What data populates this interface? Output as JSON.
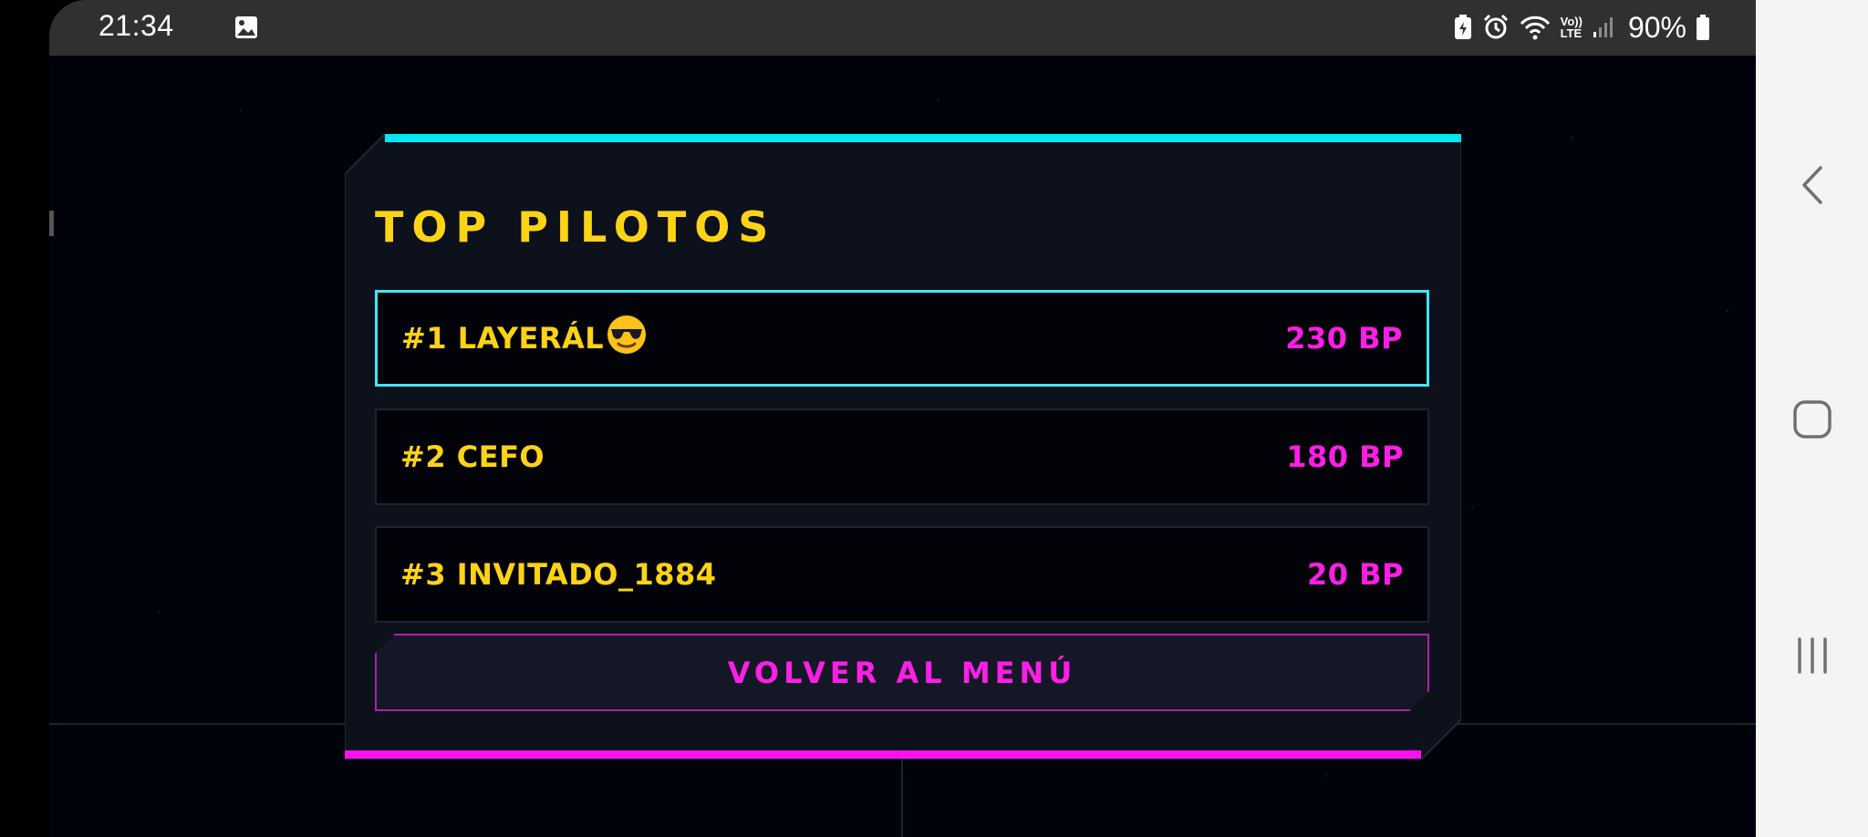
{
  "status_bar": {
    "time": "21:34",
    "battery": "90%",
    "icons": [
      "gallery-icon",
      "battery-saver-icon",
      "alarm-icon",
      "wifi-icon",
      "volte-icon",
      "signal-icon",
      "battery-icon"
    ],
    "volte_top": "Vo))",
    "volte_bottom": "LTE"
  },
  "leaderboard": {
    "title": "TOP PILOTOS",
    "entries": [
      {
        "name": "#1 LAYERÁL",
        "emoji": "😎",
        "score": "230 BP"
      },
      {
        "name": "#2 CEFO",
        "score": "180 BP"
      },
      {
        "name": "#3 INVITADO_1884",
        "score": "20 BP"
      }
    ],
    "back_button": "VOLVER AL MENÚ"
  },
  "colors": {
    "accent_cyan": "#00e8f4",
    "accent_magenta": "#ff10f0",
    "title_yellow": "#ffd315"
  },
  "nav_bar": {
    "buttons": [
      "back-icon",
      "home-icon",
      "recent-apps-icon"
    ]
  }
}
